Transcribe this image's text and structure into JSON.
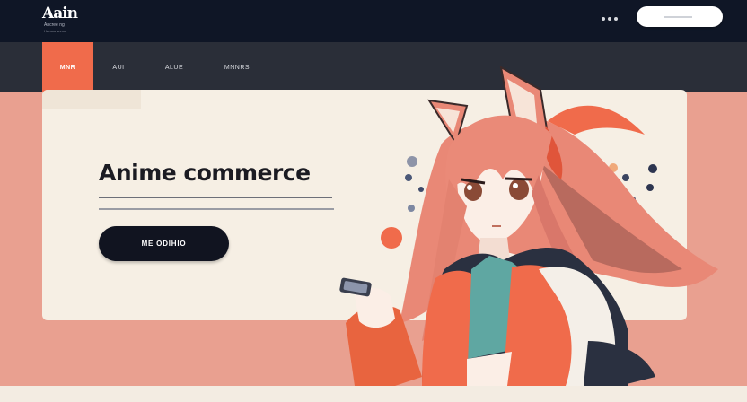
{
  "header": {
    "logo_text": "Aain",
    "logo_tagline": "Ancree ng",
    "logo_sub": "Heroos anrme"
  },
  "nav": {
    "items": [
      {
        "label": "MNR",
        "active": true
      },
      {
        "label": "AUI",
        "active": false
      },
      {
        "label": "ALUE",
        "active": false
      },
      {
        "label": "MNNRS",
        "active": false
      }
    ]
  },
  "hero": {
    "title": "Anime commerce",
    "cta_label": "ME ODIHIO"
  },
  "colors": {
    "topbar": "#0f1626",
    "navbar": "#2a2e38",
    "accent": "#f06b4b",
    "background": "#e9a090",
    "card": "#f6efe4",
    "cta": "#111420"
  }
}
